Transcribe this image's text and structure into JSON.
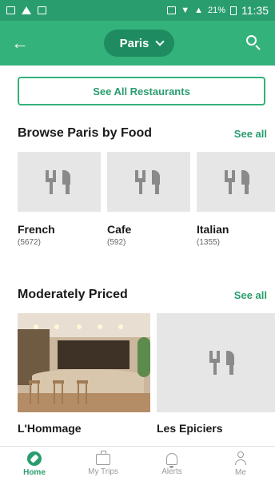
{
  "status_bar": {
    "time": "11:35",
    "battery": "21%"
  },
  "header": {
    "city": "Paris",
    "back_icon": "arrow-left-icon",
    "search_icon": "search-icon"
  },
  "main": {
    "see_all_restaurants": "See All Restaurants",
    "food_section": {
      "title": "Browse Paris by Food",
      "see_all": "See all",
      "items": [
        {
          "name": "French",
          "count": "(5672)"
        },
        {
          "name": "Cafe",
          "count": "(592)"
        },
        {
          "name": "Italian",
          "count": "(1355)"
        }
      ]
    },
    "priced_section": {
      "title": "Moderately Priced",
      "see_all": "See all",
      "items": [
        {
          "name": "L'Hommage"
        },
        {
          "name": "Les Epiciers"
        }
      ]
    }
  },
  "bottom_nav": {
    "items": [
      {
        "label": "Home",
        "icon": "compass-icon",
        "active": true
      },
      {
        "label": "My Trips",
        "icon": "suitcase-icon",
        "active": false
      },
      {
        "label": "Alerts",
        "icon": "bell-icon",
        "active": false
      },
      {
        "label": "Me",
        "icon": "person-icon",
        "active": false
      }
    ]
  },
  "colors": {
    "brand_green": "#34b27b",
    "dark_green": "#1e8c60",
    "link_green": "#2a9d6e"
  }
}
